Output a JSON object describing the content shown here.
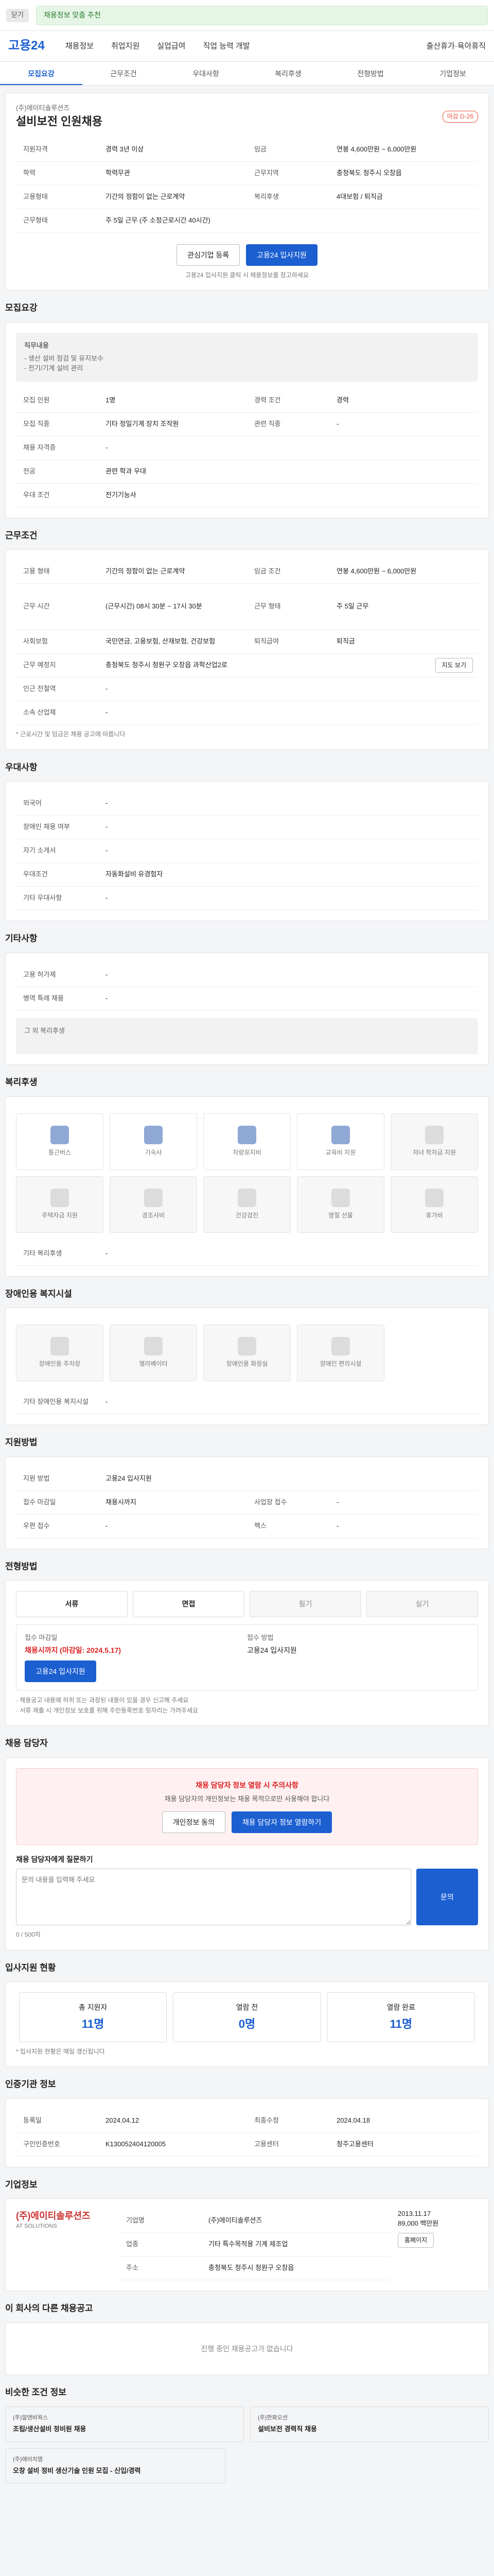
{
  "topbar": {
    "chip": "닫기",
    "notice": "채용정보 맞춤 추천"
  },
  "gnb": {
    "logo": "고용24",
    "items": [
      "채용정보",
      "취업지원",
      "실업급여",
      "직업 능력 개발",
      "출산휴가·육아휴직"
    ]
  },
  "tabs": [
    "모집요강",
    "근무조건",
    "우대사항",
    "복리후생",
    "전형방법",
    "기업정보"
  ],
  "job": {
    "title": "설비보전 인원채용",
    "badge": "마감 D-26",
    "company": "(주)에이티솔루션즈",
    "rows": [
      [
        "지원자격",
        "경력 3년 이상",
        "임금",
        "연봉 4,600만원 ~ 6,000만원"
      ],
      [
        "학력",
        "학력무관",
        "근무지역",
        "충청북도 청주시 오창읍"
      ],
      [
        "고용형태",
        "기간의 정함이 없는 근로계약",
        "복리후생",
        "4대보험 / 퇴직금"
      ],
      [
        "근무형태",
        "주 5일 근무 (주 소정근로시간 40시간)",
        "",
        ""
      ]
    ],
    "btn_interest": "관심기업 등록",
    "btn_apply": "고용24 입사지원",
    "hint": "고용24 입사지원 클릭 시 채용정보를 참고하세요"
  },
  "recruit": {
    "title": "모집요강",
    "box_title": "직무내용",
    "box_lines": [
      "- 생산 설비 점검 및 유지보수",
      "- 전기/기계 설비 관리"
    ],
    "rows": [
      [
        "모집 인원",
        "1명",
        "경력 조건",
        "경력"
      ],
      [
        "모집 직종",
        "기타 정밀기계 장치 조작원",
        "관련 직종",
        "-"
      ],
      [
        "채용 자격증",
        "-",
        "",
        ""
      ],
      [
        "전공",
        "관련 학과 우대",
        "",
        ""
      ],
      [
        "우대 조건",
        "전기기능사",
        "",
        ""
      ]
    ]
  },
  "cond": {
    "title": "근무조건",
    "rows": [
      [
        "고용 형태",
        "기간의 정함이 없는 근로계약",
        "임금 조건",
        "연봉 4,600만원 ~ 6,000만원"
      ],
      [
        "근무 시간",
        "(근무시간) 08시 30분 ~ 17시 30분",
        "근무 형태",
        "주 5일 근무"
      ],
      [
        "사회보험",
        "국민연금, 고용보험, 산재보험, 건강보험",
        "퇴직급여",
        "퇴직금"
      ],
      [
        "근무 예정지",
        "충청북도 청주시 청원구 오창읍 과학산업2로",
        "",
        ""
      ],
      [
        "인근 전철역",
        "-",
        "",
        ""
      ],
      [
        "소속 산업체",
        "-",
        "",
        ""
      ]
    ],
    "map_btn": "지도 보기",
    "footnote": "* 근로시간 및 임금은 채용 공고에 따릅니다"
  },
  "pref": {
    "title": "우대사항",
    "rows": [
      [
        "외국어",
        "-"
      ],
      [
        "장애인 채용 여부",
        "-"
      ],
      [
        "자기 소개서",
        "-"
      ],
      [
        "우대조건",
        "자동화설비 유경험자"
      ],
      [
        "기타 우대사항",
        "-"
      ]
    ]
  },
  "benefit_extra": {
    "title": "기타사항",
    "rows": [
      [
        "고용 허가제",
        "-"
      ],
      [
        "병역 특례 채용",
        "-"
      ]
    ],
    "empty": "그 외 복리후생"
  },
  "welfare": {
    "title": "복리후생",
    "tiles": [
      "통근버스",
      "기숙사",
      "차량유지비",
      "교육비 지원",
      "자녀 학자금 지원",
      "주택자금 지원",
      "경조사비",
      "건강검진",
      "명절 선물",
      "휴가비"
    ],
    "active": [
      0,
      1,
      2,
      3
    ],
    "memo_label": "기타 복리후생",
    "memo": "-"
  },
  "disable": {
    "title": "장애인용 복지시설",
    "tiles": [
      "장애인용 주차장",
      "엘리베이터",
      "장애인용 화장실",
      "장애인 편의시설"
    ],
    "memo_label": "기타 장애인용 복지시설",
    "memo": "-"
  },
  "apply": {
    "title": "지원방법",
    "rows": [
      [
        "지원 방법",
        "고용24 입사지원",
        "",
        ""
      ],
      [
        "접수 마감일",
        "채용시까지",
        "사업장 접수",
        "-"
      ],
      [
        "우편 접수",
        "-",
        "팩스",
        "-"
      ]
    ]
  },
  "process": {
    "title": "전형방법",
    "steps": [
      "서류",
      "면접",
      "필기",
      "실기"
    ],
    "left_label": "접수 마감일",
    "left_value": "채용시까지 (마감일: 2024.5.17)",
    "right_label": "접수 방법",
    "right_value": "고용24 입사지원",
    "apply_btn": "고용24 입사지원",
    "notes": [
      "· 채용공고 내용에 허위 또는 과장된 내용이 있을 경우 신고해 주세요",
      "· 서류 제출 시 개인정보 보호를 위해 주민등록번호 뒷자리는 가려주세요"
    ]
  },
  "contact": {
    "title": "채용 담당자",
    "pink_title": "채용 담당자 정보 열람 시 주의사항",
    "pink_text": "채용 담당자의 개인정보는 채용 목적으로만 사용해야 합니다",
    "b1": "개인정보 동의",
    "b2": "채용 담당자 정보 열람하기",
    "q_label": "채용 담당자에게 질문하기",
    "q_placeholder": "문의 내용을 입력해 주세요",
    "q_btn": "문의",
    "q_count": "0 / 500자"
  },
  "stats": {
    "title": "입사지원 현황",
    "items": [
      [
        "총 지원자",
        "11명"
      ],
      [
        "열람 전",
        "0명"
      ],
      [
        "열람 완료",
        "11명"
      ]
    ],
    "note": "* 입사지원 현황은 매일 갱신됩니다"
  },
  "meta": {
    "title": "인증기관 정보",
    "rows": [
      [
        "등록일",
        "2024.04.12",
        "최종수정",
        "2024.04.18"
      ],
      [
        "구인인증번호",
        "K130052404120005",
        "고용센터",
        "청주고용센터"
      ]
    ]
  },
  "company": {
    "title": "기업정보",
    "name": "(주)에이티솔루션즈",
    "en": "AT SOLUTIONS",
    "rows": [
      [
        "기업명",
        "(주)에이티솔루션즈"
      ],
      [
        "업종",
        "기타 특수목적용 기계 제조업"
      ],
      [
        "주소",
        "충청북도 청주시 청원구 오창읍"
      ]
    ],
    "since": "2013.11.17",
    "emp": "89,000 백만원",
    "btn": "홈페이지"
  },
  "other": {
    "title": "이 회사의 다른 채용공고",
    "empty": "진행 중인 채용공고가 없습니다"
  },
  "similar": {
    "title": "비슷한 조건 정보",
    "cards": [
      {
        "c": "(주)알앤비웍스",
        "t": "조립/생산설비 정비원 채용"
      },
      {
        "c": "(주)한화오션",
        "t": "설비보전 경력직 채용"
      },
      {
        "c": "(주)에이치엠",
        "t": "오창 설비 정비 생산기술 인원 모집 - 신입/경력"
      }
    ]
  }
}
